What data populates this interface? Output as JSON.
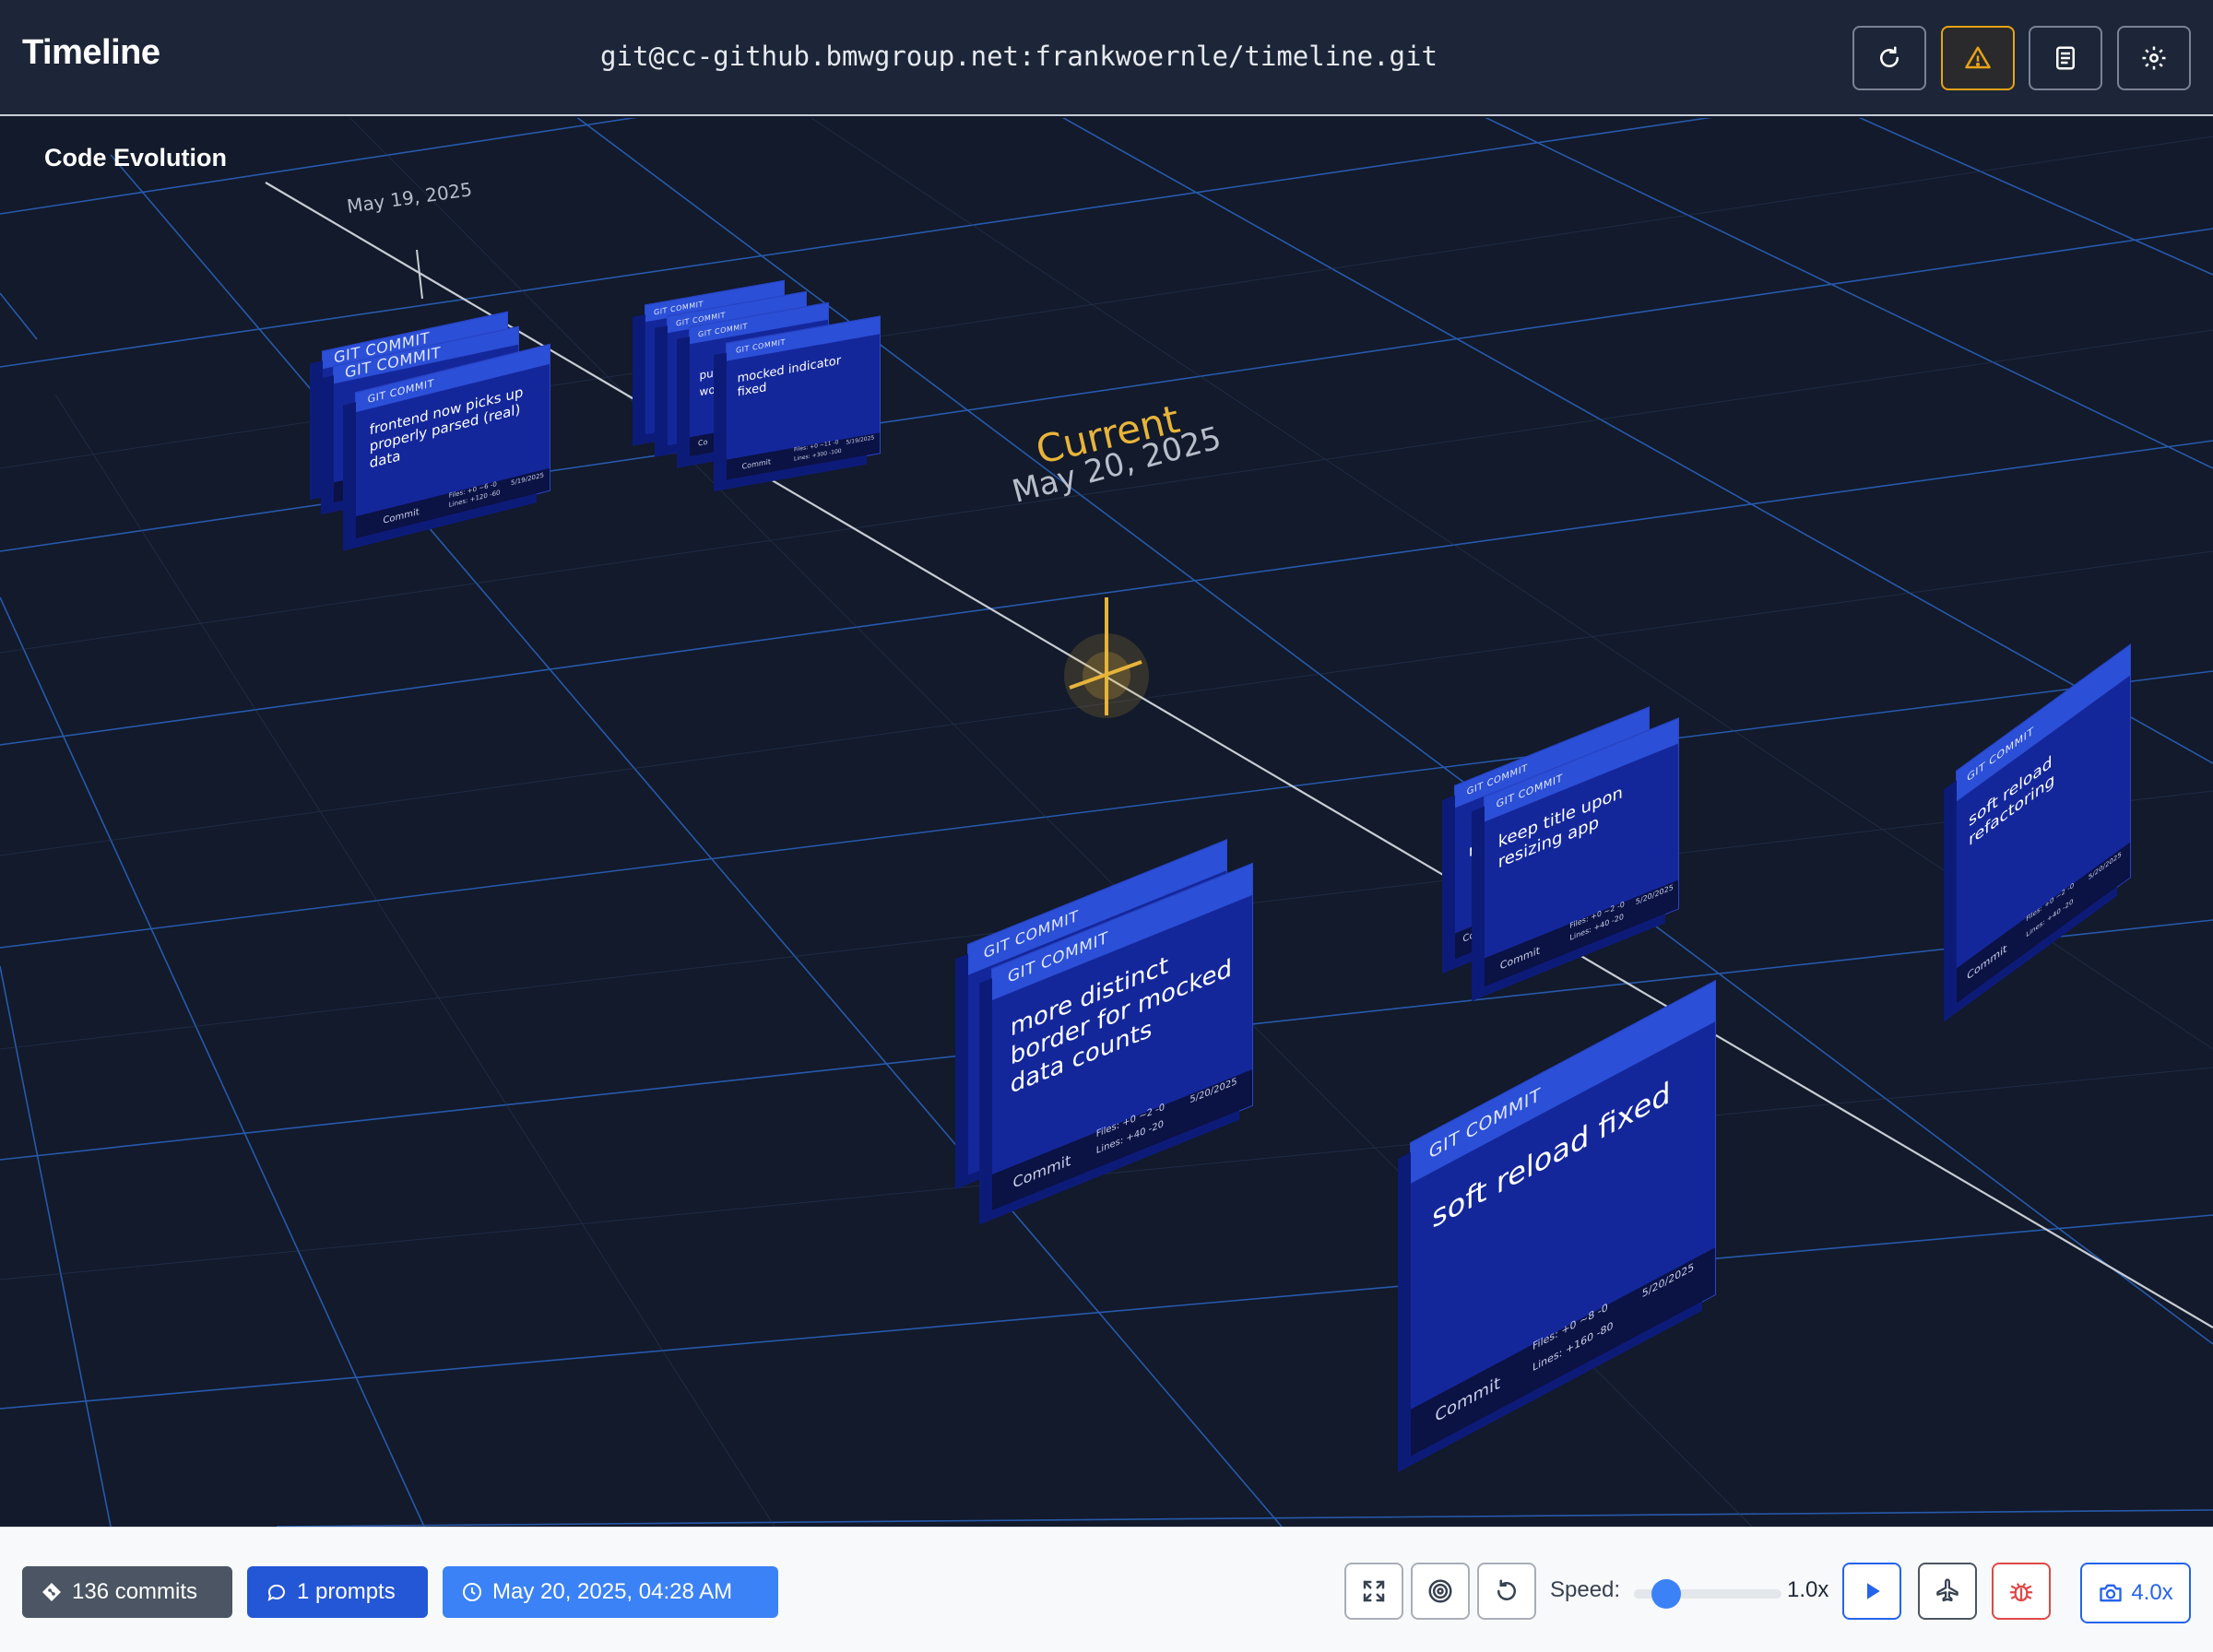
{
  "header": {
    "title": "Timeline",
    "repo_url": "git@cc-github.bmwgroup.net:frankwoernle/timeline.git",
    "buttons": [
      {
        "icon": "refresh-icon"
      },
      {
        "icon": "warning-icon",
        "accent": "#e8a317"
      },
      {
        "icon": "document-icon"
      },
      {
        "icon": "settings-gear-icon"
      }
    ]
  },
  "scene": {
    "label": "Code Evolution",
    "timeline_dates": [
      "May 19, 2025",
      "May 20, 2025"
    ],
    "current_label": "Current",
    "card_band_label": "GIT COMMIT",
    "card_footer_label": "Commit",
    "cards": [
      {
        "message": "frontend now picks up properly parsed (real) data",
        "files": "Files: +0 ~6 -0",
        "lines": "Lines: +120 -60",
        "date": "5/19/2025"
      },
      {
        "message": "mocked indicator fixed",
        "files": "Files: +0 ~11 -0",
        "lines": "Lines: +300 -100",
        "date": "5/19/2025"
      },
      {
        "message": "more distinct border for mocked data counts",
        "files": "Files: +0 ~2 -0",
        "lines": "Lines: +40 -20",
        "date": "5/20/2025"
      },
      {
        "message": "keep title upon resizing app",
        "files": "Files: +0 ~2 -0",
        "lines": "Lines: +40 -20",
        "date": "5/20/2025"
      },
      {
        "message": "soft reload fixed",
        "files": "Files: +0 ~8 -0",
        "lines": "Lines: +160 -80",
        "date": "5/20/2025"
      },
      {
        "message": "soft reload refactoring",
        "files": "Files: +0 ~2 -0",
        "lines": "Lines: +40 -20",
        "date": "5/20/2025"
      }
    ],
    "partial_card_texts": [
      "u",
      "n",
      "Co",
      "cl",
      "se",
      "pu",
      "wo",
      "Co",
      "Com",
      "re",
      "Comm"
    ],
    "colors": {
      "grid": "#2f6fd6",
      "card": "#14279a",
      "card_band": "#2b4fd6",
      "timeline": "#c9cdd4",
      "current_marker": "#e7b43a"
    }
  },
  "footer": {
    "commits_badge": "136 commits",
    "prompts_badge": "1 prompts",
    "date_badge": "May 20, 2025, 04:28 AM",
    "speed_label": "Speed:",
    "speed_value": "1.0x",
    "speed_level": 1.0,
    "camera_value": "4.0x",
    "buttons": [
      {
        "icon": "fit-view-icon"
      },
      {
        "icon": "target-icon"
      },
      {
        "icon": "reset-icon"
      },
      {
        "icon": "play-icon"
      },
      {
        "icon": "airplane-icon"
      },
      {
        "icon": "bug-icon",
        "accent": "#e04848"
      },
      {
        "icon": "camera-icon"
      }
    ]
  }
}
